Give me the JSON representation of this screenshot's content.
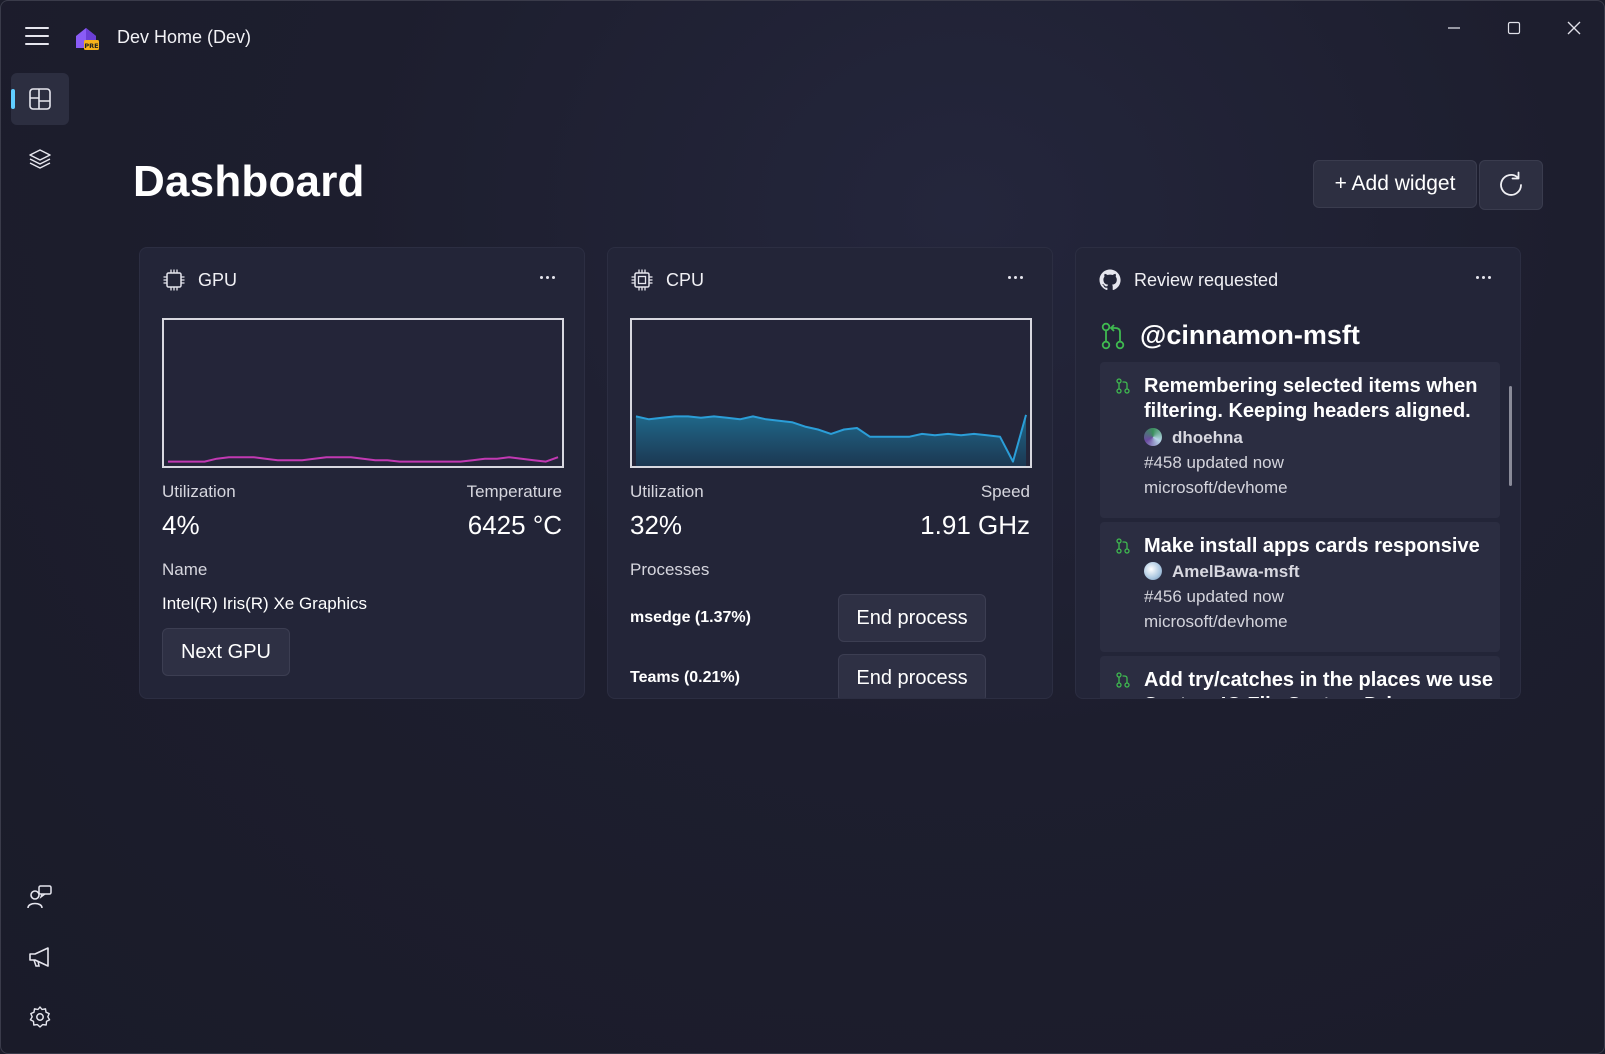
{
  "window": {
    "title": "Dev Home (Dev)",
    "logo_badge": "PRE",
    "controls": [
      "minimize-icon",
      "maximize-icon",
      "close-icon"
    ]
  },
  "nav": {
    "items": [
      {
        "name": "dashboard",
        "icon": "dashboard-icon",
        "selected": true
      },
      {
        "name": "machine-configuration",
        "icon": "layers-icon"
      }
    ],
    "footer": [
      {
        "name": "feedback",
        "icon": "feedback-icon"
      },
      {
        "name": "announcements",
        "icon": "megaphone-icon"
      },
      {
        "name": "settings",
        "icon": "gear-icon"
      }
    ],
    "accent": "#60cdff"
  },
  "page": {
    "title": "Dashboard",
    "add_widget_label": "+ Add widget"
  },
  "gpu": {
    "title": "GPU",
    "utilization_label": "Utilization",
    "utilization_value": "4%",
    "temperature_label": "Temperature",
    "temperature_value": "6425 °C",
    "name_label": "Name",
    "name_value": "Intel(R) Iris(R) Xe Graphics",
    "next_button": "Next GPU",
    "line_color": "#c239b3",
    "history": [
      3,
      3,
      3,
      3,
      5,
      6,
      6,
      6,
      5,
      4,
      4,
      4,
      5,
      6,
      6,
      6,
      5,
      4,
      4,
      3,
      3,
      3,
      3,
      3,
      3,
      4,
      5,
      5,
      6,
      5,
      4,
      3,
      6
    ]
  },
  "cpu": {
    "title": "CPU",
    "utilization_label": "Utilization",
    "utilization_value": "32%",
    "speed_label": "Speed",
    "speed_value": "1.91 GHz",
    "processes_label": "Processes",
    "processes": [
      {
        "name": "msedge (1.37%)",
        "action": "End process"
      },
      {
        "name": "Teams (0.21%)",
        "action": "End process"
      }
    ],
    "line_color": "#2b9ed8",
    "history": [
      34,
      32,
      33,
      34,
      34,
      33,
      34,
      33,
      32,
      34,
      32,
      31,
      30,
      27,
      25,
      22,
      25,
      26,
      20,
      20,
      20,
      20,
      22,
      21,
      22,
      21,
      22,
      21,
      20,
      3,
      35
    ]
  },
  "pull_requests": {
    "title": "Review requested",
    "user": "@cinnamon-msft",
    "items": [
      {
        "title": "Remembering selected items when filtering.  Keeping headers aligned.",
        "author": "dhoehna",
        "number": "#458 updated now",
        "repo": "microsoft/devhome"
      },
      {
        "title": "Make install apps cards responsive",
        "author": "AmelBawa-msft",
        "number": "#456 updated now",
        "repo": "microsoft/devhome"
      },
      {
        "title": "Add try/catches in the places we use System.IO.File.System.Drive",
        "author": "",
        "number": "",
        "repo": ""
      }
    ],
    "icon_color": "#3fb950"
  }
}
